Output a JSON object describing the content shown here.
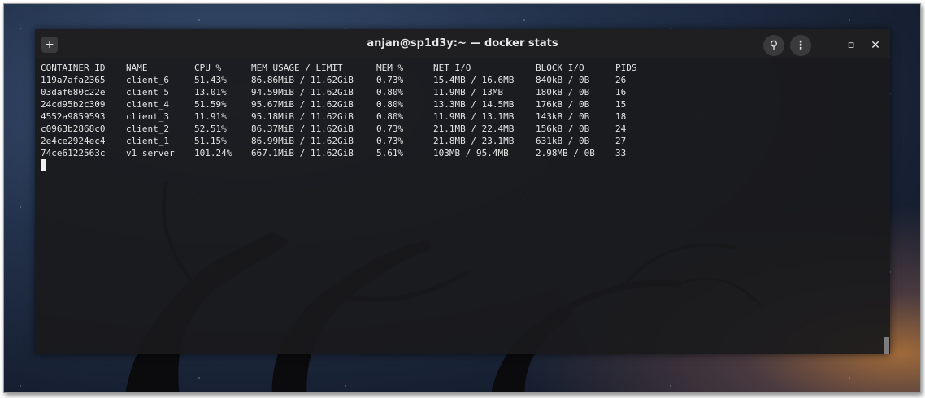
{
  "window": {
    "title": "anjan@sp1d3y:~ — docker stats",
    "new_tab_icon": "+",
    "search_icon": "⚲",
    "menu_icon": "⋮",
    "minimize_icon": "–",
    "maximize_icon": "▫",
    "close_icon": "✕"
  },
  "stats": {
    "headers": [
      "CONTAINER ID",
      "NAME",
      "CPU %",
      "MEM USAGE / LIMIT",
      "MEM %",
      "NET I/O",
      "BLOCK I/O",
      "PIDS"
    ],
    "rows": [
      [
        "119a7afa2365",
        "client_6",
        "51.43%",
        "86.86MiB / 11.62GiB",
        "0.73%",
        "15.4MB / 16.6MB",
        "840kB / 0B",
        "26"
      ],
      [
        "03daf680c22e",
        "client_5",
        "13.01%",
        "94.59MiB / 11.62GiB",
        "0.80%",
        "11.9MB / 13MB",
        "180kB / 0B",
        "16"
      ],
      [
        "24cd95b2c309",
        "client_4",
        "51.59%",
        "95.67MiB / 11.62GiB",
        "0.80%",
        "13.3MB / 14.5MB",
        "176kB / 0B",
        "15"
      ],
      [
        "4552a9859593",
        "client_3",
        "11.91%",
        "95.18MiB / 11.62GiB",
        "0.80%",
        "11.9MB / 13.1MB",
        "143kB / 0B",
        "18"
      ],
      [
        "c0963b2868c0",
        "client_2",
        "52.51%",
        "86.37MiB / 11.62GiB",
        "0.73%",
        "21.1MB / 22.4MB",
        "156kB / 0B",
        "24"
      ],
      [
        "2e4ce2924ec4",
        "client_1",
        "51.15%",
        "86.99MiB / 11.62GiB",
        "0.73%",
        "21.8MB / 23.1MB",
        "631kB / 0B",
        "27"
      ],
      [
        "74ce6122563c",
        "v1_server",
        "101.24%",
        "667.1MiB / 11.62GiB",
        "5.61%",
        "103MB / 95.4MB",
        "2.98MB / 0B",
        "33"
      ]
    ]
  }
}
